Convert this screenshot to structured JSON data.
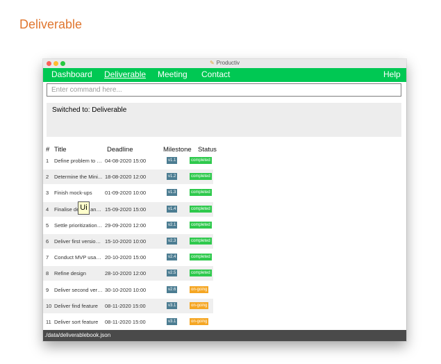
{
  "page": {
    "heading": "Deliverable"
  },
  "window": {
    "title": "Productiv"
  },
  "menu": {
    "items": [
      "Dashboard",
      "Deliverable",
      "Meeting",
      "Contact"
    ],
    "help": "Help",
    "active": "Deliverable"
  },
  "command": {
    "placeholder": "Enter command here..."
  },
  "result": {
    "text": "Switched to: Deliverable"
  },
  "list": {
    "headers": {
      "num": "#",
      "title": "Title",
      "deadline": "Deadline",
      "milestone": "Milestone",
      "status": "Status"
    },
    "rows": [
      {
        "num": "1",
        "title": "Define problem to s...",
        "deadline": "04-08-2020 15:00",
        "milestone": "v1.1",
        "status": "completed"
      },
      {
        "num": "2",
        "title": "Determine the Mini...",
        "deadline": "18-08-2020 12:00",
        "milestone": "v1.2",
        "status": "completed"
      },
      {
        "num": "3",
        "title": "Finish mock-ups",
        "deadline": "01-09-2020 10:00",
        "milestone": "v1.3",
        "status": "completed"
      },
      {
        "num": "4",
        "title": "Finalise design and ...",
        "deadline": "15-09-2020 15:00",
        "milestone": "v1.4",
        "status": "completed"
      },
      {
        "num": "5",
        "title": "Settle prioritization o...",
        "deadline": "29-09-2020 12:00",
        "milestone": "v2.1",
        "status": "completed"
      },
      {
        "num": "6",
        "title": "Deliver first version ...",
        "deadline": "15-10-2020 10:00",
        "milestone": "v2.3",
        "status": "completed"
      },
      {
        "num": "7",
        "title": "Conduct MVP usabil...",
        "deadline": "20-10-2020 15:00",
        "milestone": "v2.4",
        "status": "completed"
      },
      {
        "num": "8",
        "title": "Refine design",
        "deadline": "28-10-2020 12:00",
        "milestone": "v2.5",
        "status": "completed"
      },
      {
        "num": "9",
        "title": "Deliver second versi...",
        "deadline": "30-10-2020 10:00",
        "milestone": "v2.6",
        "status": "on-going"
      },
      {
        "num": "10",
        "title": "Deliver find feature",
        "deadline": "08-11-2020 15:00",
        "milestone": "v3.1",
        "status": "on-going"
      },
      {
        "num": "11",
        "title": "Deliver sort feature",
        "deadline": "08-11-2020 15:00",
        "milestone": "v3.1",
        "status": "on-going"
      }
    ]
  },
  "tooltip": {
    "text": "Ui"
  },
  "status_bar": {
    "text": "./data/deliverablebook.json"
  },
  "colors": {
    "menubar": "#00c853",
    "heading": "#e0762f",
    "completed": "#2ec94c",
    "ongoing": "#f5a623",
    "milestone": "#4c7d92"
  }
}
